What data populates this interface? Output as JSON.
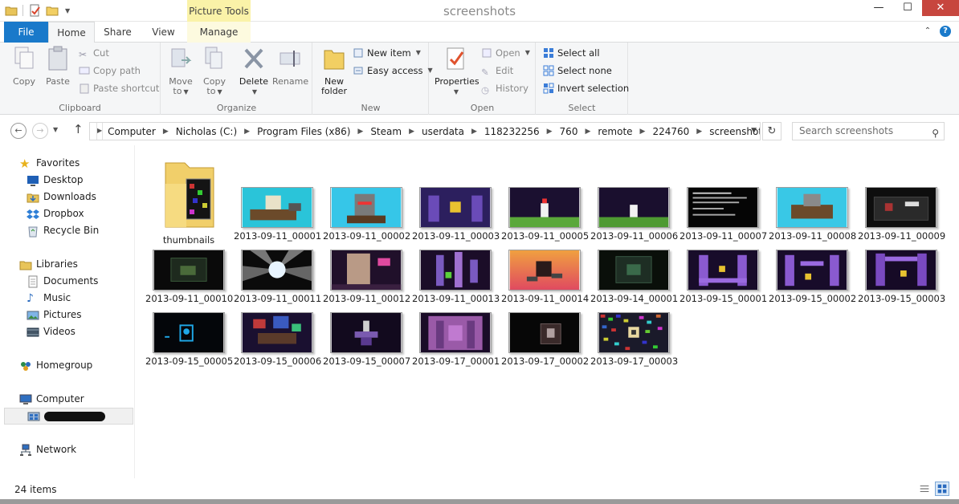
{
  "window": {
    "title": "screenshots",
    "contextual_tab_group": "Picture Tools"
  },
  "ribbon_tabs": {
    "file": "File",
    "home": "Home",
    "share": "Share",
    "view": "View",
    "manage": "Manage"
  },
  "ribbon": {
    "clipboard": {
      "label": "Clipboard",
      "copy": "Copy",
      "paste": "Paste",
      "cut": "Cut",
      "copy_path": "Copy path",
      "paste_shortcut": "Paste shortcut"
    },
    "organize": {
      "label": "Organize",
      "move_to_1": "Move",
      "move_to_2": "to",
      "copy_to_1": "Copy",
      "copy_to_2": "to",
      "delete": "Delete",
      "rename": "Rename"
    },
    "new": {
      "label": "New",
      "new_folder_1": "New",
      "new_folder_2": "folder",
      "new_item": "New item",
      "easy_access": "Easy access"
    },
    "open": {
      "label": "Open",
      "properties": "Properties",
      "open": "Open",
      "edit": "Edit",
      "history": "History"
    },
    "select": {
      "label": "Select",
      "select_all": "Select all",
      "select_none": "Select none",
      "invert_selection": "Invert selection"
    }
  },
  "address_bar": {
    "crumbs": [
      "Computer",
      "Nicholas (C:)",
      "Program Files (x86)",
      "Steam",
      "userdata",
      "118232256",
      "760",
      "remote",
      "224760",
      "screenshots"
    ]
  },
  "search": {
    "placeholder": "Search screenshots"
  },
  "nav_pane": {
    "favorites": "Favorites",
    "desktop": "Desktop",
    "downloads": "Downloads",
    "dropbox": "Dropbox",
    "recycle_bin": "Recycle Bin",
    "libraries": "Libraries",
    "documents": "Documents",
    "music": "Music",
    "pictures": "Pictures",
    "videos": "Videos",
    "homegroup": "Homegroup",
    "computer": "Computer",
    "network": "Network"
  },
  "files": {
    "folder": "thumbnails",
    "items": [
      "2013-09-11_00001",
      "2013-09-11_00002",
      "2013-09-11_00003",
      "2013-09-11_00005",
      "2013-09-11_00006",
      "2013-09-11_00007",
      "2013-09-11_00008",
      "2013-09-11_00009",
      "2013-09-11_00010",
      "2013-09-11_00011",
      "2013-09-11_00012",
      "2013-09-11_00013",
      "2013-09-11_00014",
      "2013-09-14_00001",
      "2013-09-15_00001",
      "2013-09-15_00002",
      "2013-09-15_00003",
      "2013-09-15_00005",
      "2013-09-15_00006",
      "2013-09-15_00007",
      "2013-09-17_00001",
      "2013-09-17_00002",
      "2013-09-17_00003"
    ]
  },
  "status": {
    "item_count": "24 items"
  },
  "colors": {
    "accent": "#1979ca",
    "contextual": "#faf2a8",
    "close": "#c7463e"
  }
}
